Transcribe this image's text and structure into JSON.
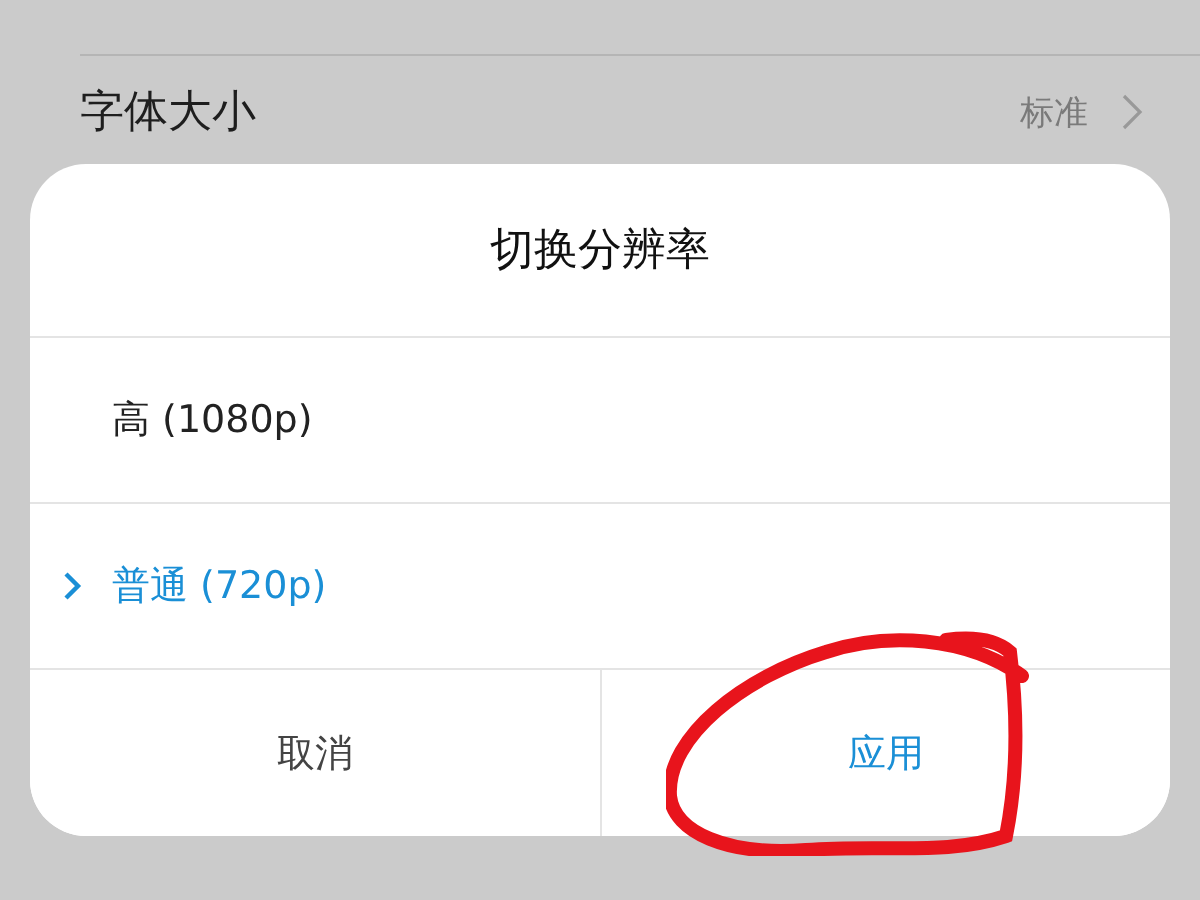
{
  "setting_row": {
    "label": "字体大小",
    "value": "标准"
  },
  "dialog": {
    "title": "切换分辨率",
    "options": [
      {
        "label": "高 (1080p)",
        "selected": false
      },
      {
        "label": "普通 (720p)",
        "selected": true
      }
    ],
    "buttons": [
      {
        "label": "取消",
        "kind": "cancel"
      },
      {
        "label": "应用",
        "kind": "confirm"
      }
    ]
  }
}
